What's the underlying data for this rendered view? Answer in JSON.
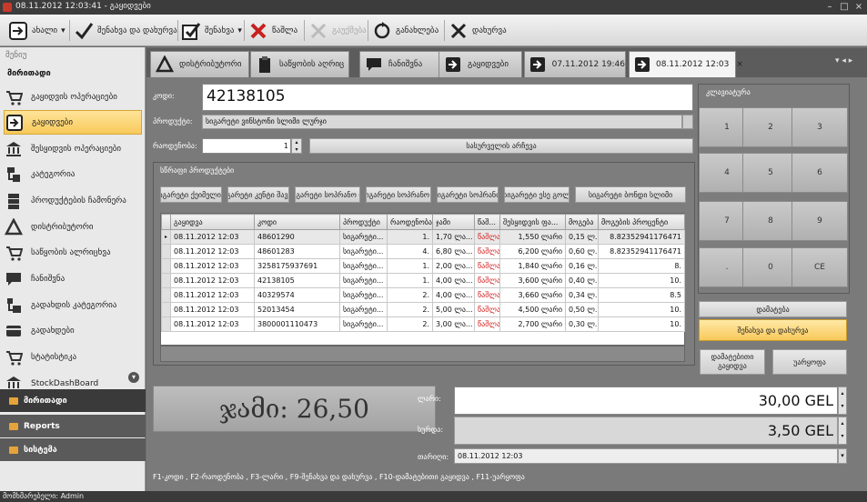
{
  "title_bar": {
    "title": "08.11.2012 12:03:41 - გაყიდვები"
  },
  "toolbar": {
    "new": "ახალი",
    "save_close": "შენახვა და დახურვა",
    "save": "შენახვა",
    "delete": "წაშლა",
    "disabled": "გაუქმება",
    "refresh": "განახლება",
    "close": "დახურვა"
  },
  "sidebar": {
    "caption": "მენიუ",
    "section": "მირითადი",
    "items": [
      "გაყიდვის ოპერაციები",
      "გაყიდვები",
      "შესყიდვის ოპერაციები",
      "კატეგორია",
      "პროდუქტების ჩამონერა",
      "დისტრიბუტორი",
      "საწყობის ალრიცხვა",
      "ჩანიშვნა",
      "გადახდის კატეგორია",
      "გადახდები",
      "სტატისტიკა",
      "StockDashBoard"
    ],
    "groups": [
      "მირითადი",
      "Reports",
      "სისტემა"
    ]
  },
  "tabs": [
    "დისტრიბუტორი",
    "საწყობის აღრიც",
    "ჩანიშვნა",
    "გაყიდვები",
    "07.11.2012 19:46",
    "08.11.2012 12:03"
  ],
  "form": {
    "code_label": "კოდი:",
    "code_value": "42138105",
    "product_label": "პროდუქტი:",
    "product_value": "სიგარეტი ვინსტონი სლიმი ლურჯი",
    "qty_label": "რაოდენობა:",
    "qty_value": "1",
    "choose_btn": "სასურველის არჩევა",
    "quick_title": "სწრაფი პროდუქტები"
  },
  "quick_buttons": [
    "სიგარეტი ქეიმელი ს",
    "სიგარეტი კენტი შავი კ",
    "სიგარეტი სოპრანო ლ",
    "სიგარეტი სოპრანო ვ",
    "სიგარეტი სოპრანო",
    "სიგარეტი ესე გოლ",
    "სიგარეტი ბონდი სლიმი"
  ],
  "grid": {
    "headers": [
      "გაყიდვა",
      "კოდი",
      "პროდუქტი",
      "რაოდენობა",
      "ჯამი",
      "წაშ...",
      "შესყიდვის ფა...",
      "მოგება",
      "მოგების პროცენტი"
    ],
    "rows": [
      [
        "08.11.2012 12:03",
        "48601290",
        "სიგარეტი...",
        "1.",
        "1,70 ლა...",
        "წაშლა",
        "1,550 ლარი",
        "0,15 ლ.",
        "8.82352941176471"
      ],
      [
        "08.11.2012 12:03",
        "48601283",
        "სიგარეტი...",
        "4.",
        "6,80 ლა...",
        "წაშლა",
        "6,200 ლარი",
        "0,60 ლ.",
        "8.82352941176471"
      ],
      [
        "08.11.2012 12:03",
        "3258175937691",
        "სიგარეტი...",
        "1.",
        "2,00 ლა...",
        "წაშლა",
        "1,840 ლარი",
        "0,16 ლ.",
        "8."
      ],
      [
        "08.11.2012 12:03",
        "42138105",
        "სიგარეტი...",
        "1.",
        "4,00 ლა...",
        "წაშლა",
        "3,600 ლარი",
        "0,40 ლ.",
        "10."
      ],
      [
        "08.11.2012 12:03",
        "40329574",
        "სიგარეტი...",
        "2.",
        "4,00 ლა...",
        "წაშლა",
        "3,660 ლარი",
        "0,34 ლ.",
        "8.5"
      ],
      [
        "08.11.2012 12:03",
        "52013454",
        "სიგარეტი...",
        "2.",
        "5,00 ლა...",
        "წაშლა",
        "4,500 ლარი",
        "0,50 ლ.",
        "10."
      ],
      [
        "08.11.2012 12:03",
        "3800001110473",
        "სიგარეტი...",
        "2.",
        "3,00 ლა...",
        "წაშლა",
        "2,700 ლარი",
        "0,30 ლ.",
        "10."
      ]
    ]
  },
  "total": {
    "label": "ჯამი: 26,50"
  },
  "payment": {
    "paid_label": "ლარი:",
    "paid_value": "30,00 GEL",
    "change_label": "ხურდა:",
    "change_value": "3,50 GEL",
    "date_label": "თარიღი:",
    "date_value": "08.11.2012 12:03"
  },
  "keypad": {
    "title": "კლავიატურა",
    "keys": [
      "1",
      "2",
      "3",
      "4",
      "5",
      "6",
      "7",
      "8",
      "9",
      ".",
      "0",
      "CE"
    ]
  },
  "actions": {
    "add": "დამატება",
    "save_close": "შენახვა და დახურვა",
    "additional": "დამატებითი გაყიდვა",
    "cancel": "უარყოფა"
  },
  "hints": "F1-კოდი , F2-რაოდენობა , F3-ლარი , F9-შენახვა და დახურვა , F10-დამატებითი გაყიდვა , F11-უარყოფა",
  "status": "მომხმარებელი: Admin",
  "colors": {
    "accent": "#f8c95a",
    "delete_text": "#d42020",
    "bg": "#7a7a7a"
  }
}
